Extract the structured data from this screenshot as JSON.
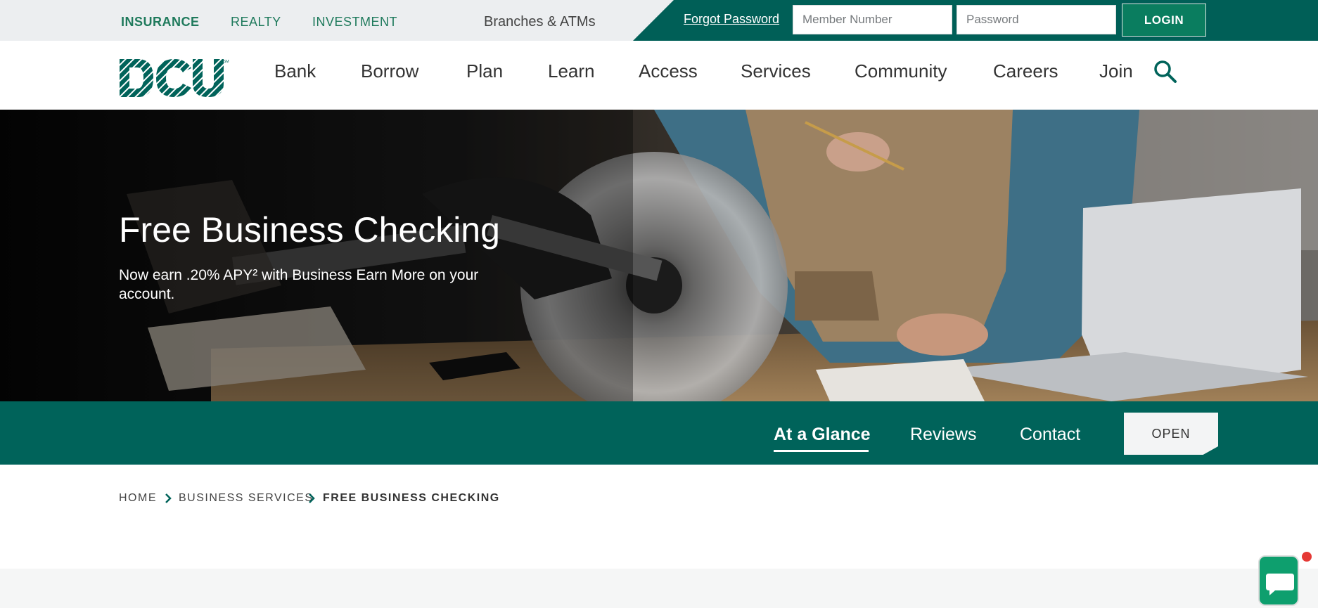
{
  "utility": {
    "links": [
      "INSURANCE",
      "REALTY",
      "INVESTMENT"
    ],
    "branches": "Branches & ATMs",
    "forgot_password": "Forgot Password",
    "member_placeholder": "Member Number",
    "password_placeholder": "Password",
    "login_label": "LOGIN"
  },
  "nav": {
    "items": [
      "Bank",
      "Borrow",
      "Plan",
      "Learn",
      "Access",
      "Services",
      "Community",
      "Careers",
      "Join"
    ]
  },
  "hero": {
    "title": "Free Business Checking",
    "subtitle": "Now earn .20% APY² with Business Earn More on your account."
  },
  "subnav": {
    "tabs": [
      "At a Glance",
      "Reviews",
      "Contact"
    ],
    "open_label": "OPEN"
  },
  "breadcrumb": [
    "HOME",
    "BUSINESS SERVICES",
    "FREE BUSINESS CHECKING"
  ],
  "colors": {
    "brand_green": "#005f57",
    "accent_green": "#1f7a5c",
    "chat_green": "#0e9f6e"
  }
}
